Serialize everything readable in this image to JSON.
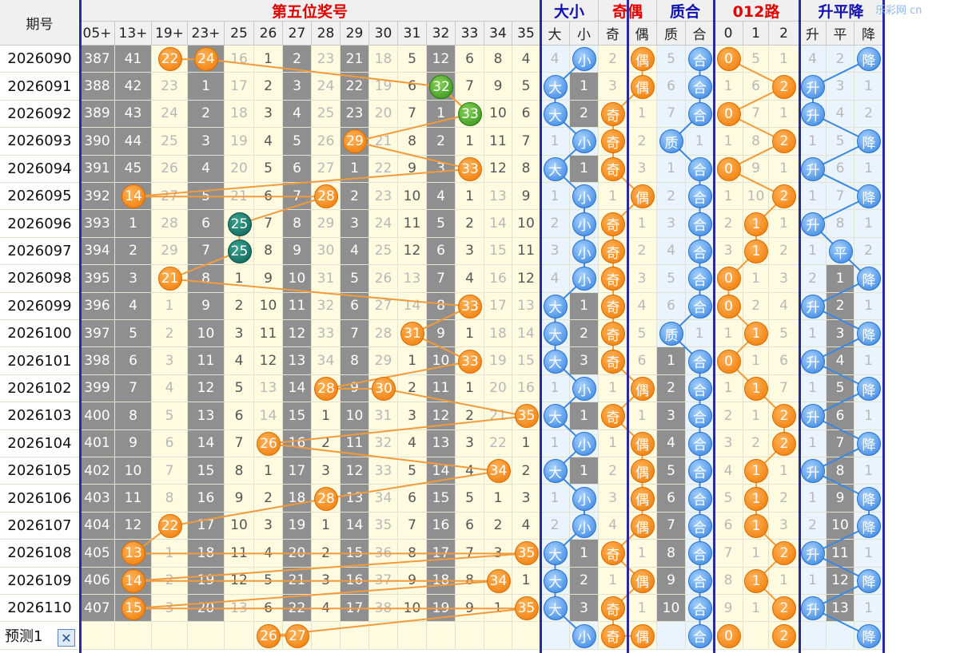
{
  "header": {
    "period_label": "期号",
    "group_titles": {
      "main": "第五位奖号",
      "daxiao": "大小",
      "jiou": "奇偶",
      "zhihe": "质合",
      "lu012": "012路",
      "shengping": "升平降"
    },
    "brand": "乐彩网 cn",
    "col_labels": [
      "05+",
      "13+",
      "19+",
      "23+",
      "25",
      "26",
      "27",
      "28",
      "29",
      "30",
      "31",
      "32",
      "33",
      "34",
      "35",
      "大",
      "小",
      "奇",
      "偶",
      "质",
      "合",
      "0",
      "1",
      "2",
      "升",
      "平",
      "降"
    ]
  },
  "rows": [
    {
      "period": "2026090",
      "main": [
        "387",
        "41",
        "22",
        "24",
        "16",
        "1",
        "2",
        "23",
        "21",
        "18",
        "5",
        "12",
        "6",
        "8",
        "4"
      ],
      "dx": [
        "4",
        "小"
      ],
      "jo": [
        "2",
        "偶"
      ],
      "zh": [
        "5",
        "合"
      ],
      "lu": [
        "0",
        "5",
        "1"
      ],
      "sp": [
        "4",
        "2",
        "降"
      ]
    },
    {
      "period": "2026091",
      "main": [
        "388",
        "42",
        "23",
        "1",
        "17",
        "2",
        "3",
        "24",
        "22",
        "19",
        "6",
        "32",
        "7",
        "9",
        "5"
      ],
      "dx": [
        "大",
        "1"
      ],
      "jo": [
        "3",
        "偶"
      ],
      "zh": [
        "6",
        "合"
      ],
      "lu": [
        "1",
        "6",
        "2"
      ],
      "sp": [
        "升",
        "3",
        "1"
      ]
    },
    {
      "period": "2026092",
      "main": [
        "389",
        "43",
        "24",
        "2",
        "18",
        "3",
        "4",
        "25",
        "23",
        "20",
        "7",
        "1",
        "33",
        "10",
        "6"
      ],
      "dx": [
        "大",
        "2"
      ],
      "jo": [
        "奇",
        "1"
      ],
      "zh": [
        "7",
        "合"
      ],
      "lu": [
        "0",
        "7",
        "1"
      ],
      "sp": [
        "升",
        "4",
        "2"
      ]
    },
    {
      "period": "2026093",
      "main": [
        "390",
        "44",
        "25",
        "3",
        "19",
        "4",
        "5",
        "26",
        "29",
        "21",
        "8",
        "2",
        "1",
        "11",
        "7"
      ],
      "dx": [
        "1",
        "小"
      ],
      "jo": [
        "奇",
        "2"
      ],
      "zh": [
        "质",
        "1"
      ],
      "lu": [
        "1",
        "8",
        "2"
      ],
      "sp": [
        "1",
        "5",
        "降"
      ]
    },
    {
      "period": "2026094",
      "main": [
        "391",
        "45",
        "26",
        "4",
        "20",
        "5",
        "6",
        "27",
        "1",
        "22",
        "9",
        "3",
        "33",
        "12",
        "8"
      ],
      "dx": [
        "大",
        "1"
      ],
      "jo": [
        "奇",
        "3"
      ],
      "zh": [
        "1",
        "合"
      ],
      "lu": [
        "0",
        "9",
        "1"
      ],
      "sp": [
        "升",
        "6",
        "1"
      ]
    },
    {
      "period": "2026095",
      "main": [
        "392",
        "14",
        "27",
        "5",
        "21",
        "6",
        "7",
        "28",
        "2",
        "23",
        "10",
        "4",
        "1",
        "13",
        "9"
      ],
      "dx": [
        "1",
        "小"
      ],
      "jo": [
        "1",
        "偶"
      ],
      "zh": [
        "2",
        "合"
      ],
      "lu": [
        "1",
        "10",
        "2"
      ],
      "sp": [
        "1",
        "7",
        "降"
      ]
    },
    {
      "period": "2026096",
      "main": [
        "393",
        "1",
        "28",
        "6",
        "25",
        "7",
        "8",
        "29",
        "3",
        "24",
        "11",
        "5",
        "2",
        "14",
        "10"
      ],
      "dx": [
        "2",
        "小"
      ],
      "jo": [
        "奇",
        "1"
      ],
      "zh": [
        "3",
        "合"
      ],
      "lu": [
        "2",
        "1",
        "1"
      ],
      "sp": [
        "升",
        "8",
        "1"
      ]
    },
    {
      "period": "2026097",
      "main": [
        "394",
        "2",
        "29",
        "7",
        "25",
        "8",
        "9",
        "30",
        "4",
        "25",
        "12",
        "6",
        "3",
        "15",
        "11"
      ],
      "dx": [
        "3",
        "小"
      ],
      "jo": [
        "奇",
        "2"
      ],
      "zh": [
        "4",
        "合"
      ],
      "lu": [
        "3",
        "1",
        "2"
      ],
      "sp": [
        "1",
        "平",
        "2"
      ]
    },
    {
      "period": "2026098",
      "main": [
        "395",
        "3",
        "21",
        "8",
        "1",
        "9",
        "10",
        "31",
        "5",
        "26",
        "13",
        "7",
        "4",
        "16",
        "12"
      ],
      "dx": [
        "4",
        "小"
      ],
      "jo": [
        "奇",
        "3"
      ],
      "zh": [
        "5",
        "合"
      ],
      "lu": [
        "0",
        "1",
        "3"
      ],
      "sp": [
        "2",
        "1",
        "降"
      ]
    },
    {
      "period": "2026099",
      "main": [
        "396",
        "4",
        "1",
        "9",
        "2",
        "10",
        "11",
        "32",
        "6",
        "27",
        "14",
        "8",
        "33",
        "17",
        "13"
      ],
      "dx": [
        "大",
        "1"
      ],
      "jo": [
        "奇",
        "4"
      ],
      "zh": [
        "6",
        "合"
      ],
      "lu": [
        "0",
        "2",
        "4"
      ],
      "sp": [
        "升",
        "2",
        "1"
      ]
    },
    {
      "period": "2026100",
      "main": [
        "397",
        "5",
        "2",
        "10",
        "3",
        "11",
        "12",
        "33",
        "7",
        "28",
        "31",
        "9",
        "1",
        "18",
        "14"
      ],
      "dx": [
        "大",
        "2"
      ],
      "jo": [
        "奇",
        "5"
      ],
      "zh": [
        "质",
        "1"
      ],
      "lu": [
        "1",
        "1",
        "5"
      ],
      "sp": [
        "1",
        "3",
        "降"
      ]
    },
    {
      "period": "2026101",
      "main": [
        "398",
        "6",
        "3",
        "11",
        "4",
        "12",
        "13",
        "34",
        "8",
        "29",
        "1",
        "10",
        "33",
        "19",
        "15"
      ],
      "dx": [
        "大",
        "3"
      ],
      "jo": [
        "奇",
        "6"
      ],
      "zh": [
        "1",
        "合"
      ],
      "lu": [
        "0",
        "1",
        "6"
      ],
      "sp": [
        "升",
        "4",
        "1"
      ]
    },
    {
      "period": "2026102",
      "main": [
        "399",
        "7",
        "4",
        "12",
        "5",
        "13",
        "14",
        "28",
        "9",
        "30",
        "2",
        "11",
        "1",
        "20",
        "16"
      ],
      "dx": [
        "1",
        "小"
      ],
      "jo": [
        "1",
        "偶"
      ],
      "zh": [
        "2",
        "合"
      ],
      "lu": [
        "1",
        "1",
        "7"
      ],
      "sp": [
        "1",
        "5",
        "降"
      ]
    },
    {
      "period": "2026103",
      "main": [
        "400",
        "8",
        "5",
        "13",
        "6",
        "14",
        "15",
        "1",
        "10",
        "31",
        "3",
        "12",
        "2",
        "21",
        "35"
      ],
      "dx": [
        "大",
        "1"
      ],
      "jo": [
        "奇",
        "1"
      ],
      "zh": [
        "3",
        "合"
      ],
      "lu": [
        "2",
        "1",
        "2"
      ],
      "sp": [
        "升",
        "6",
        "1"
      ]
    },
    {
      "period": "2026104",
      "main": [
        "401",
        "9",
        "6",
        "14",
        "7",
        "26",
        "16",
        "2",
        "11",
        "32",
        "4",
        "13",
        "3",
        "22",
        "1"
      ],
      "dx": [
        "1",
        "小"
      ],
      "jo": [
        "1",
        "偶"
      ],
      "zh": [
        "4",
        "合"
      ],
      "lu": [
        "3",
        "2",
        "2"
      ],
      "sp": [
        "1",
        "7",
        "降"
      ]
    },
    {
      "period": "2026105",
      "main": [
        "402",
        "10",
        "7",
        "15",
        "8",
        "1",
        "17",
        "3",
        "12",
        "33",
        "5",
        "14",
        "4",
        "34",
        "2"
      ],
      "dx": [
        "大",
        "1"
      ],
      "jo": [
        "2",
        "偶"
      ],
      "zh": [
        "5",
        "合"
      ],
      "lu": [
        "4",
        "1",
        "1"
      ],
      "sp": [
        "升",
        "8",
        "1"
      ]
    },
    {
      "period": "2026106",
      "main": [
        "403",
        "11",
        "8",
        "16",
        "9",
        "2",
        "18",
        "28",
        "13",
        "34",
        "6",
        "15",
        "5",
        "1",
        "3"
      ],
      "dx": [
        "1",
        "小"
      ],
      "jo": [
        "3",
        "偶"
      ],
      "zh": [
        "6",
        "合"
      ],
      "lu": [
        "5",
        "1",
        "2"
      ],
      "sp": [
        "1",
        "9",
        "降"
      ]
    },
    {
      "period": "2026107",
      "main": [
        "404",
        "12",
        "22",
        "17",
        "10",
        "3",
        "19",
        "1",
        "14",
        "35",
        "7",
        "16",
        "6",
        "2",
        "4"
      ],
      "dx": [
        "2",
        "小"
      ],
      "jo": [
        "4",
        "偶"
      ],
      "zh": [
        "7",
        "合"
      ],
      "lu": [
        "6",
        "1",
        "3"
      ],
      "sp": [
        "2",
        "10",
        "降"
      ]
    },
    {
      "period": "2026108",
      "main": [
        "405",
        "13",
        "1",
        "18",
        "11",
        "4",
        "20",
        "2",
        "15",
        "36",
        "8",
        "17",
        "7",
        "3",
        "35"
      ],
      "dx": [
        "大",
        "1"
      ],
      "jo": [
        "奇",
        "1"
      ],
      "zh": [
        "8",
        "合"
      ],
      "lu": [
        "7",
        "1",
        "2"
      ],
      "sp": [
        "升",
        "11",
        "1"
      ]
    },
    {
      "period": "2026109",
      "main": [
        "406",
        "14",
        "2",
        "19",
        "12",
        "5",
        "21",
        "3",
        "16",
        "37",
        "9",
        "18",
        "8",
        "34",
        "1"
      ],
      "dx": [
        "大",
        "2"
      ],
      "jo": [
        "1",
        "偶"
      ],
      "zh": [
        "9",
        "合"
      ],
      "lu": [
        "8",
        "1",
        "1"
      ],
      "sp": [
        "1",
        "12",
        "降"
      ]
    },
    {
      "period": "2026110",
      "main": [
        "407",
        "15",
        "3",
        "20",
        "13",
        "6",
        "22",
        "4",
        "17",
        "38",
        "10",
        "19",
        "9",
        "1",
        "35"
      ],
      "dx": [
        "大",
        "3"
      ],
      "jo": [
        "奇",
        "1"
      ],
      "zh": [
        "10",
        "合"
      ],
      "lu": [
        "9",
        "1",
        "2"
      ],
      "sp": [
        "升",
        "13",
        "1"
      ]
    }
  ],
  "predict": {
    "label": "预测1",
    "close_icon": "close-icon",
    "main": [
      "",
      "",
      "",
      "",
      "",
      "26",
      "27",
      "",
      "",
      "",
      "",
      "",
      "",
      "",
      ""
    ],
    "dx": [
      "",
      "小"
    ],
    "jo": [
      "奇",
      "偶"
    ],
    "zh": [
      "",
      "合"
    ],
    "lu": [
      "0",
      "",
      "2"
    ],
    "sp": [
      "",
      "",
      "降"
    ]
  },
  "colors": {
    "accent_red": "#e00000",
    "accent_blue": "#1010b0",
    "ball_orange": "#f07800",
    "ball_blue": "#2f80e0",
    "ball_green": "#2f8f14",
    "ball_teal": "#0b5e52"
  }
}
